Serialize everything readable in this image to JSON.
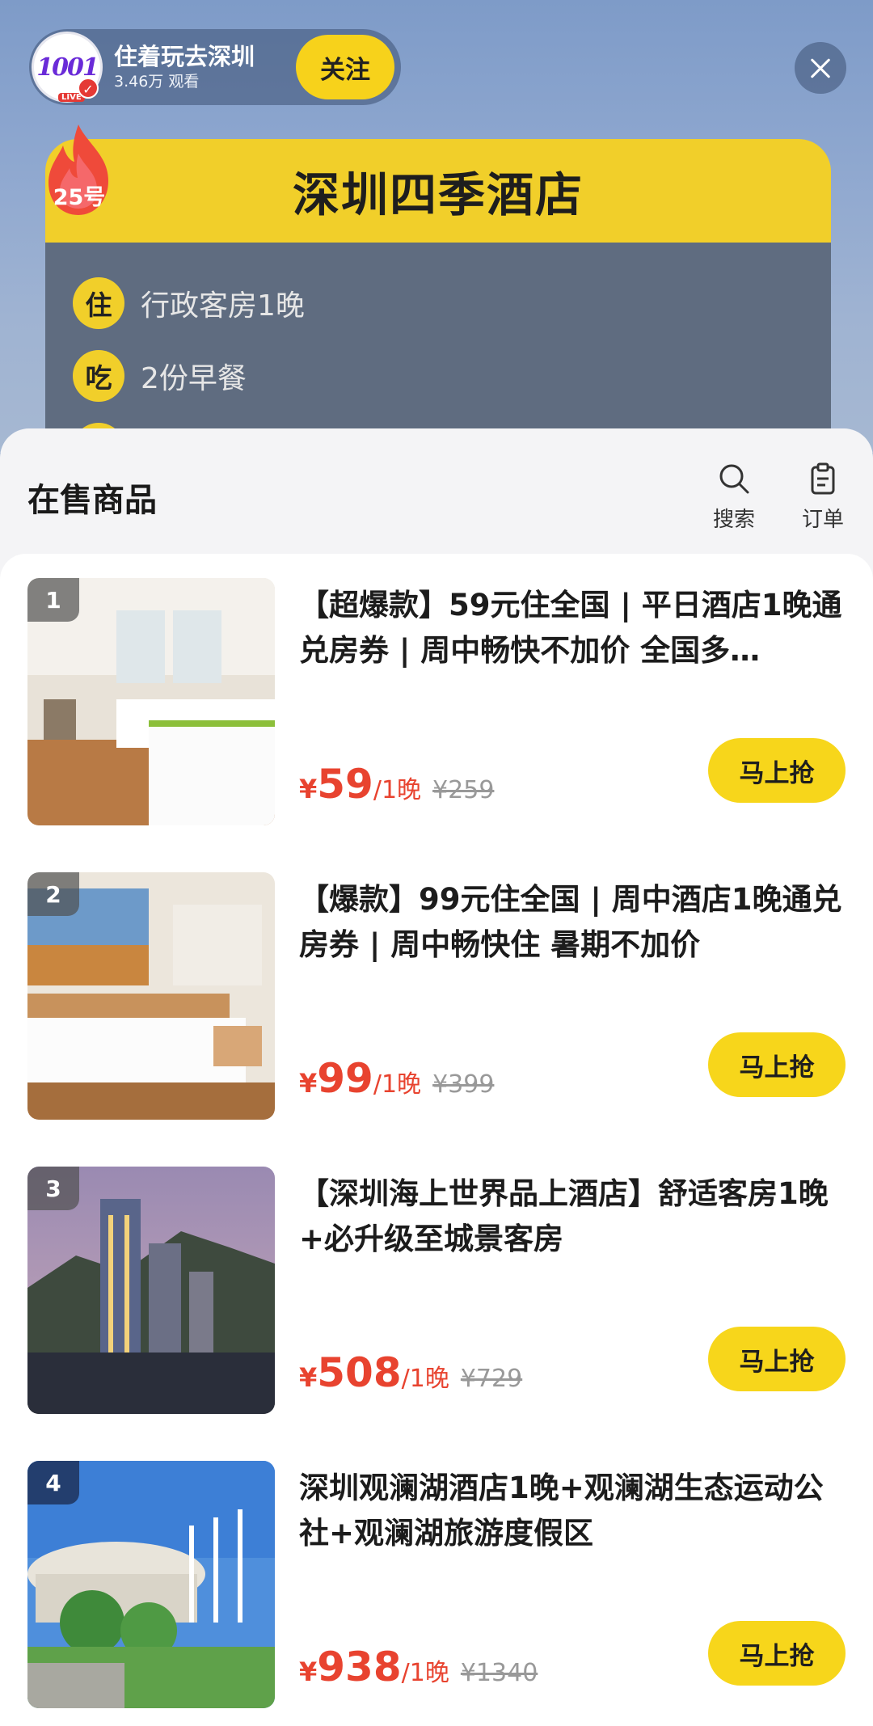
{
  "host": {
    "avatar_logo": "1001",
    "avatar_badge": "LIVE",
    "name": "住着玩去深圳",
    "views": "3.46万 观看",
    "follow_label": "关注"
  },
  "hotel_card": {
    "badge": "25号",
    "title": "深圳四季酒店",
    "perks": [
      {
        "icon": "住",
        "text": "行政客房1晚"
      },
      {
        "icon": "吃",
        "text": "2份早餐"
      }
    ]
  },
  "sheet": {
    "title": "在售商品",
    "search_label": "搜索",
    "orders_label": "订单"
  },
  "products": [
    {
      "rank": "1",
      "title": "【超爆款】59元住全国 | 平日酒店1晚通兑房券 | 周中畅快不加价 全国多…",
      "yen": "¥",
      "price": "59",
      "unit": "/1晚",
      "original": "¥259",
      "buy_label": "马上抢"
    },
    {
      "rank": "2",
      "title": "【爆款】99元住全国 | 周中酒店1晚通兑房券 | 周中畅快住 暑期不加价",
      "yen": "¥",
      "price": "99",
      "unit": "/1晚",
      "original": "¥399",
      "buy_label": "马上抢"
    },
    {
      "rank": "3",
      "title": "【深圳海上世界品上酒店】舒适客房1晚+必升级至城景客房",
      "yen": "¥",
      "price": "508",
      "unit": "/1晚",
      "original": "¥729",
      "buy_label": "马上抢"
    },
    {
      "rank": "4",
      "title": "深圳观澜湖酒店1晚+观澜湖生态运动公社+观澜湖旅游度假区",
      "yen": "¥",
      "price": "938",
      "unit": "/1晚",
      "original": "¥1340",
      "buy_label": "马上抢"
    }
  ],
  "colors": {
    "accent_yellow": "#f7d61b",
    "price_red": "#e8432f"
  }
}
